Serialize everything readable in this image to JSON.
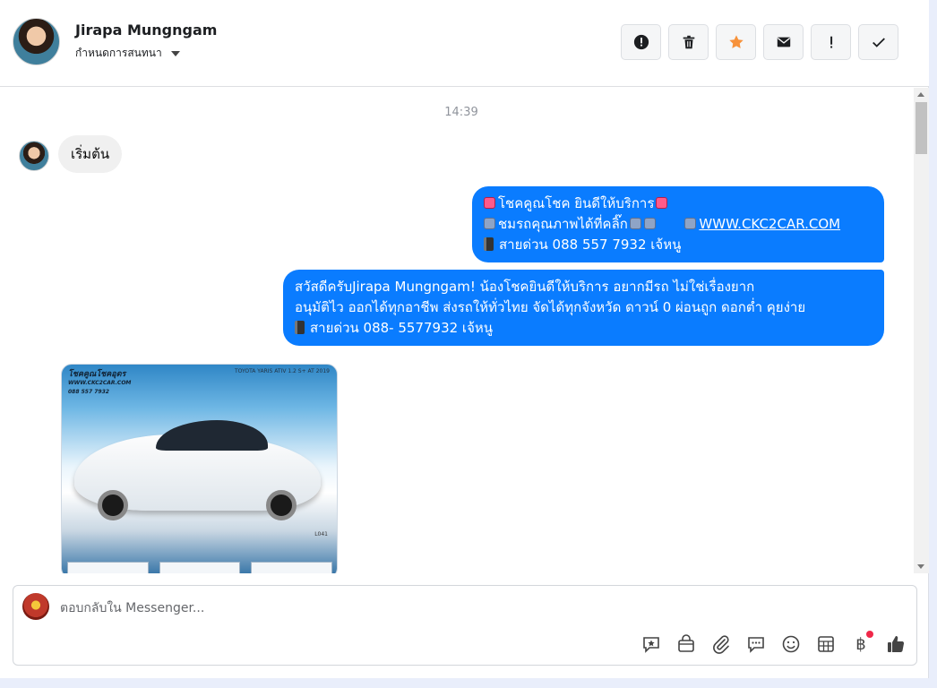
{
  "header": {
    "contact_name": "Jirapa Mungngam",
    "label_menu": "กำหนดการสนทนา",
    "actions": [
      {
        "name": "report-spam-button",
        "icon": "alert-circle-icon"
      },
      {
        "name": "delete-button",
        "icon": "trash-icon"
      },
      {
        "name": "star-button",
        "icon": "star-icon"
      },
      {
        "name": "mark-unread-button",
        "icon": "envelope-icon"
      },
      {
        "name": "follow-up-button",
        "icon": "exclamation-icon"
      },
      {
        "name": "mark-done-button",
        "icon": "check-icon"
      }
    ]
  },
  "thread": {
    "timestamp": "14:39",
    "incoming_1": "เริ่มต้น",
    "outgoing_1": {
      "line1": "โชคคูณโชค ยินดีให้บริการ",
      "line2a": "ชมรถคุณภาพได้ที่คลิ๊ก",
      "line2_link": "WWW.CKC2CAR.COM",
      "line3": "สายด่วน 088 557 7932 เจ้หนู"
    },
    "outgoing_2": {
      "line1": "สวัสดีครับJirapa Mungngam! น้องโชคยินดีให้บริการ อยากมีรถ ไม่ใช่เรื่องยาก",
      "line2": "อนุมัติไว ออกได้ทุกอาชีพ ส่งรถให้ทั่วไทย จัดได้ทุกจังหวัด ดาวน์ 0  ผ่อนถูก ดอกต่ำ คุยง่าย",
      "line3": "สายด่วน 088- 5577932 เจ้หนู"
    },
    "image": {
      "brand_line1": "โชคคูณโชคอุดร",
      "brand_line2": "WWW.CKC2CAR.COM",
      "brand_line3": "088 557 7932",
      "model": "TOYOTA YARIS ATIV 1.2 S+ AT 2019",
      "code": "L041"
    }
  },
  "composer": {
    "placeholder": "ตอบกลับใน Messenger...",
    "tools": [
      "saved-reply-icon",
      "shop-bag-icon",
      "attachment-icon",
      "chat-bubble-icon",
      "emoji-icon",
      "table-icon",
      "baht-icon",
      "thumbs-up-icon"
    ],
    "baht_symbol": "฿"
  },
  "colors": {
    "accent": "#0a7cff",
    "incoming_bubble": "#f0f0f0",
    "star": "#f7923b",
    "notification_dot": "#f02849"
  }
}
